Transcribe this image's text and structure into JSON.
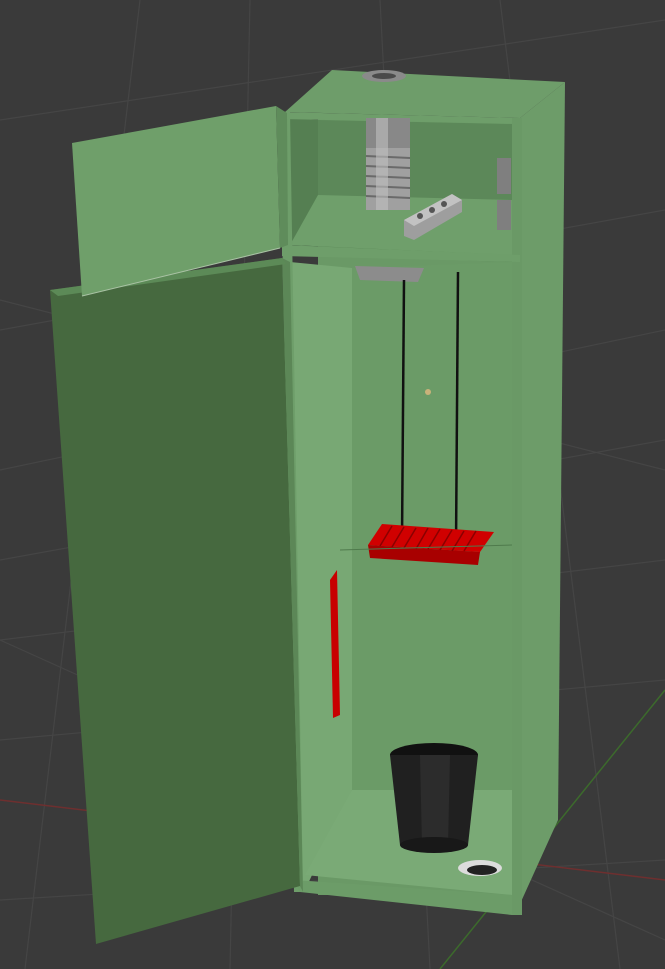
{
  "scene": {
    "background_color": "#3a3a3a",
    "grid_color": "#444444",
    "axis_x_color": "#7a3030",
    "axis_y_color": "#3f6b2e",
    "cabinet_color": "#6b9a68",
    "cabinet_dark_color": "#4e7a4c",
    "cabinet_light_color": "#7fae7a",
    "door_color": "#46683f",
    "part_red_color": "#cc0000",
    "metal_color": "#9c9c9c",
    "bucket_color": "#1e1e1e"
  },
  "objects": [
    {
      "name": "cabinet",
      "icon": "cabinet-body"
    },
    {
      "name": "open-door",
      "icon": "door-panel"
    },
    {
      "name": "top-flap",
      "icon": "flap-panel"
    },
    {
      "name": "spindle",
      "icon": "threaded-rod"
    },
    {
      "name": "bracket",
      "icon": "metal-bracket"
    },
    {
      "name": "comb-holder",
      "icon": "red-comb"
    },
    {
      "name": "side-bar",
      "icon": "red-bar"
    },
    {
      "name": "waste-bin",
      "icon": "bucket"
    }
  ]
}
